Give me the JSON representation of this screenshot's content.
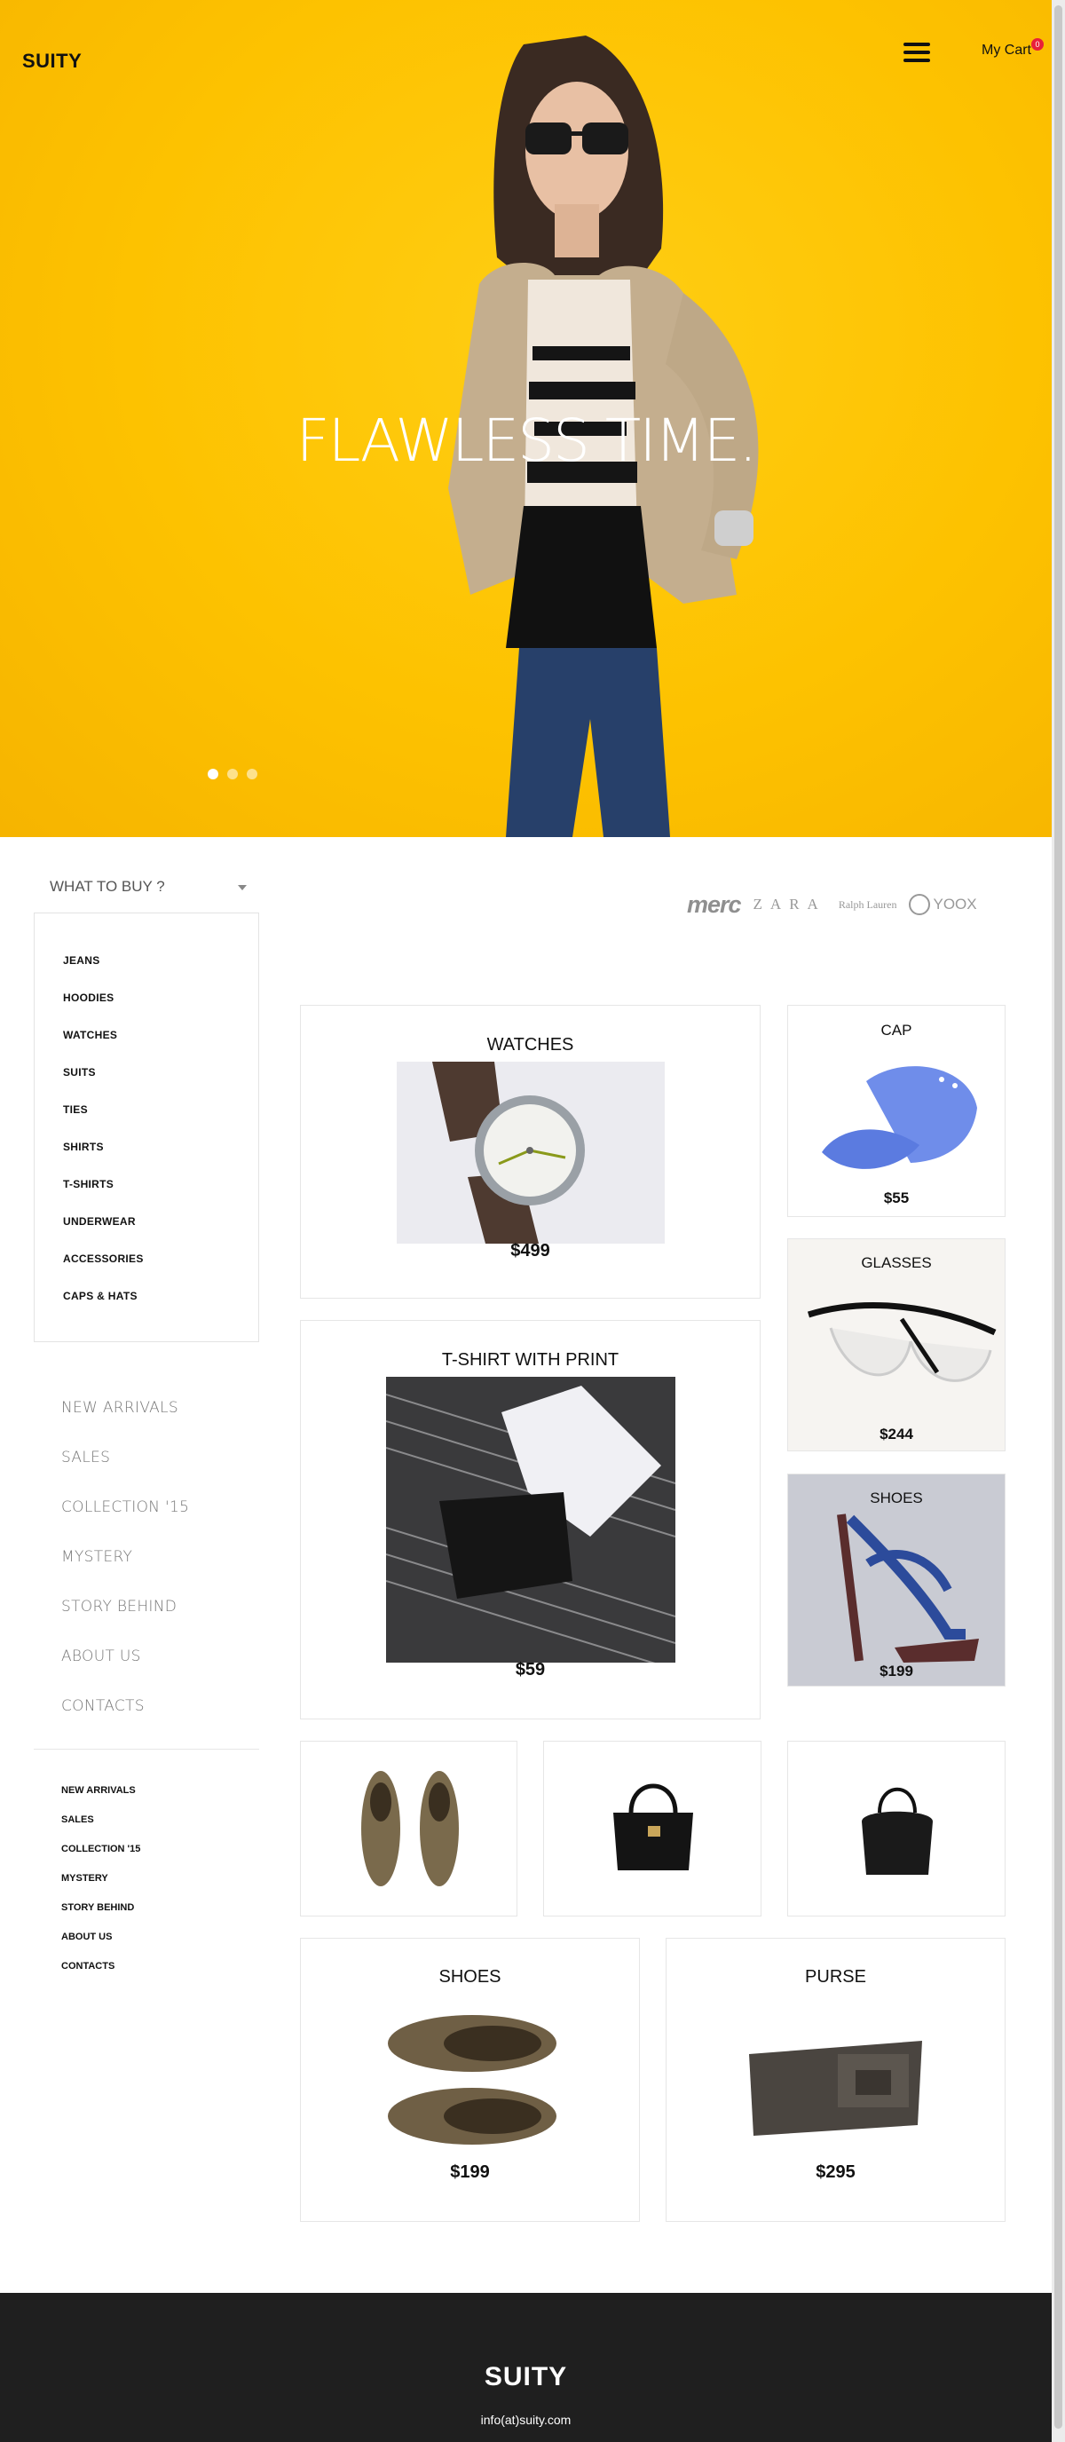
{
  "header": {
    "logo": "SUITY",
    "cart_label": "My Cart",
    "cart_count": "0"
  },
  "hero": {
    "title": "FLAWLESS TIME.",
    "slides": 3,
    "active_slide": 1
  },
  "sidebar": {
    "dropdown_label": "WHAT TO BUY ?",
    "categories": [
      "JEANS",
      "HOODIES",
      "WATCHES",
      "SUITS",
      "TIES",
      "SHIRTS",
      "T-SHIRTS",
      "UNDERWEAR",
      "ACCESSORIES",
      "CAPS & HATS"
    ],
    "nav": [
      "NEW ARRIVALS",
      "SALES",
      "COLLECTION '15",
      "MYSTERY",
      "STORY BEHIND",
      "ABOUT US",
      "CONTACTS"
    ],
    "nav_small": [
      "NEW ARRIVALS",
      "SALES",
      "COLLECTION '15",
      "MYSTERY",
      "STORY BEHIND",
      "ABOUT US",
      "CONTACTS"
    ]
  },
  "brands": [
    "merc",
    "ZARA",
    "Ralph Lauren",
    "YOOX"
  ],
  "products": {
    "watches": {
      "title": "WATCHES",
      "price": "$499"
    },
    "cap": {
      "title": "CAP",
      "price": "$55"
    },
    "glasses": {
      "title": "GLASSES",
      "price": "$244"
    },
    "tshirt": {
      "title": "T-SHIRT WITH PRINT",
      "price": "$59"
    },
    "shoes_heels": {
      "title": "SHOES",
      "price": "$199"
    },
    "shoes": {
      "title": "SHOES",
      "price": "$199"
    },
    "purse": {
      "title": "PURSE",
      "price": "$295"
    }
  },
  "footer": {
    "logo": "SUITY",
    "email": "info(at)suity.com"
  },
  "colors": {
    "hero_bg": "#fdc200",
    "footer_bg": "#1f1f1f",
    "badge": "#e8203a"
  }
}
